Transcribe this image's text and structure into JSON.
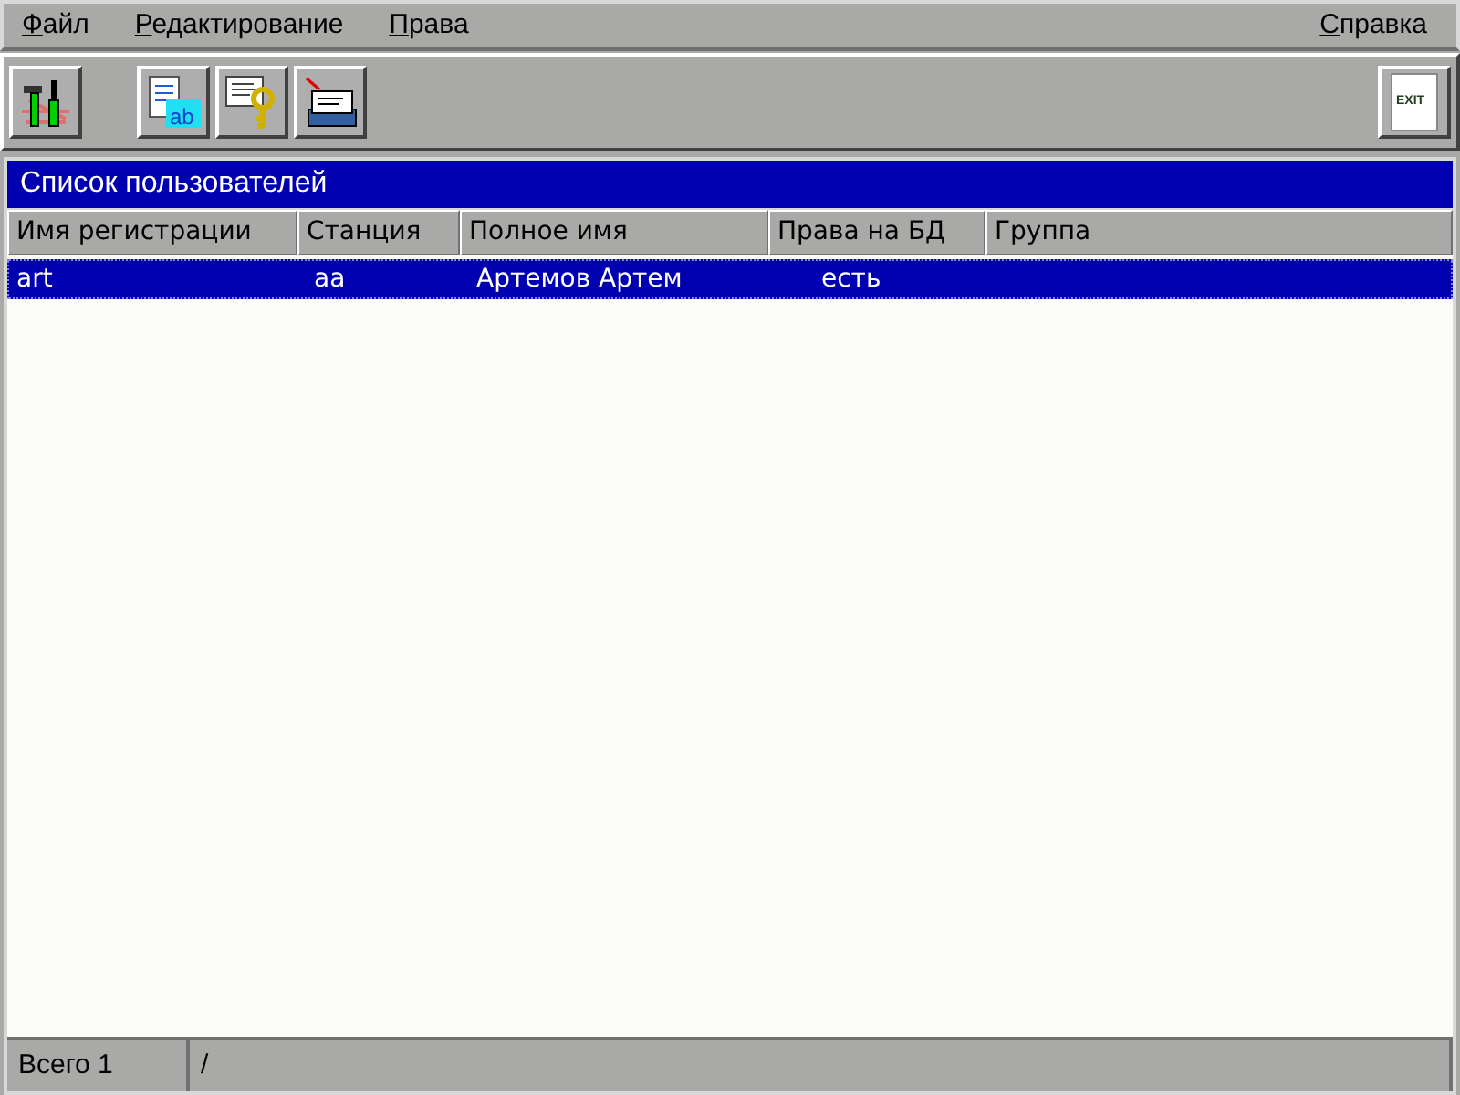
{
  "menu": [
    {
      "label": "Файл"
    },
    {
      "label": "Редактирование"
    },
    {
      "label": "Права"
    },
    {
      "label": "Справка"
    }
  ],
  "toolbar": {
    "rename_icon_text": "ab",
    "exit_label": "EXIT"
  },
  "panel_title": "Список пользователей",
  "table": {
    "columns": [
      "Имя регистрации",
      "Станция",
      "Полное имя",
      "Права на БД",
      "Группа"
    ],
    "rows": [
      {
        "selected": true,
        "cells": [
          "art",
          "aa",
          "Артемов Артем",
          "есть",
          ""
        ]
      }
    ]
  },
  "status_bar": [
    "Всего 1",
    "/"
  ]
}
